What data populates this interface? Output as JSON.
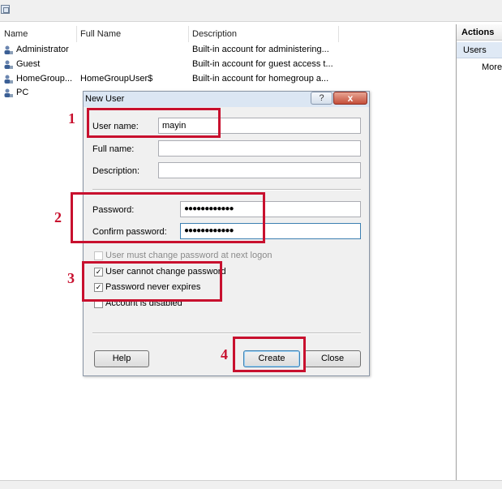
{
  "columns": [
    "Name",
    "Full Name",
    "Description"
  ],
  "users": [
    {
      "name": "Administrator",
      "full_name": "",
      "description": "Built-in account for administering..."
    },
    {
      "name": "Guest",
      "full_name": "",
      "description": "Built-in account for guest access t..."
    },
    {
      "name": "HomeGroup...",
      "full_name": "HomeGroupUser$",
      "description": "Built-in account for homegroup a..."
    },
    {
      "name": "PC",
      "full_name": "",
      "description": ""
    }
  ],
  "actions": {
    "header": "Actions",
    "section": "Users",
    "more": "More"
  },
  "dialog": {
    "title": "New User",
    "help_glyph": "?",
    "close_glyph": "x",
    "username_label": "User name:",
    "username_value": "mayin",
    "fullname_label": "Full name:",
    "fullname_value": "",
    "description_label": "Description:",
    "description_value": "",
    "password_label": "Password:",
    "password_value": "●●●●●●●●●●●●",
    "confirm_label": "Confirm password:",
    "confirm_value": "●●●●●●●●●●●●",
    "checkboxes": [
      {
        "label": "User must change password at next logon",
        "checked": false,
        "enabled": false
      },
      {
        "label": "User cannot change password",
        "checked": true,
        "enabled": true
      },
      {
        "label": "Password never expires",
        "checked": true,
        "enabled": true
      },
      {
        "label": "Account is disabled",
        "checked": false,
        "enabled": true
      }
    ],
    "help_button": "Help",
    "create_button": "Create",
    "close_button": "Close"
  },
  "annotations": [
    "1",
    "2",
    "3",
    "4"
  ],
  "colors": {
    "annotation": "#c8102e",
    "selected_row": "#dfe9f5"
  }
}
